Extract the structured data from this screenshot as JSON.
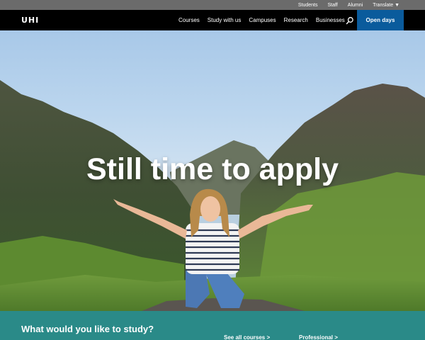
{
  "utility": {
    "links": [
      "Students",
      "Staff",
      "Alumni",
      "Translate ▼"
    ]
  },
  "nav": {
    "logo": "UHI",
    "links": [
      "Courses",
      "Study with us",
      "Campuses",
      "Research",
      "Businesses"
    ],
    "cta": "Open days"
  },
  "hero": {
    "title": "Still time to apply"
  },
  "study": {
    "heading": "What would you like to study?",
    "see_all": "See all courses >",
    "professional": "Professional >"
  },
  "colors": {
    "utility_bg": "#6b6b6b",
    "nav_bg": "#000000",
    "cta_bg": "#0a5b9c",
    "teal": "#2a8a88"
  }
}
